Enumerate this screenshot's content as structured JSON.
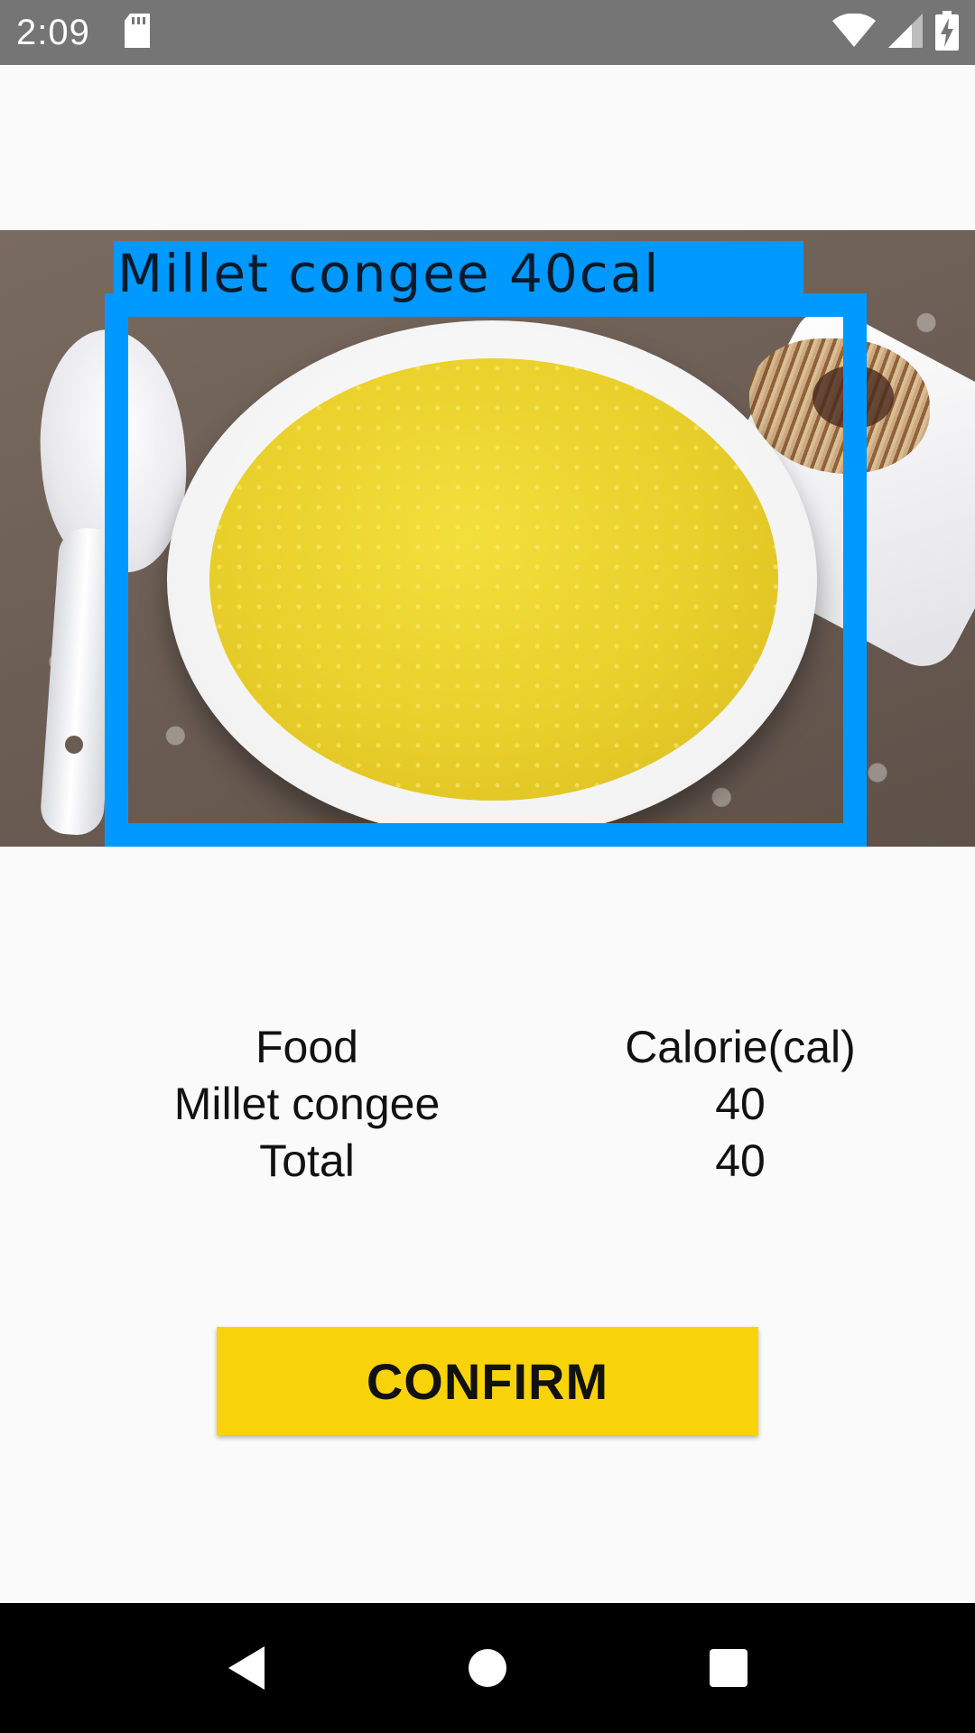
{
  "status_bar": {
    "time": "2:09",
    "icons": [
      "sd-card-icon",
      "wifi-icon",
      "cellular-signal-icon",
      "battery-charging-icon"
    ]
  },
  "photo": {
    "detection_label": "Millet  congee  40cal",
    "box_color": "#0099ff"
  },
  "table": {
    "headers": {
      "food": "Food",
      "calorie": "Calorie(cal)"
    },
    "rows": [
      {
        "food": "Millet congee",
        "calorie": "40"
      },
      {
        "food": "Total",
        "calorie": "40"
      }
    ]
  },
  "confirm_button": {
    "label": "CONFIRM",
    "color": "#f9d30a"
  },
  "nav_bar": {
    "icons": [
      "back-icon",
      "home-icon",
      "recents-icon"
    ]
  }
}
